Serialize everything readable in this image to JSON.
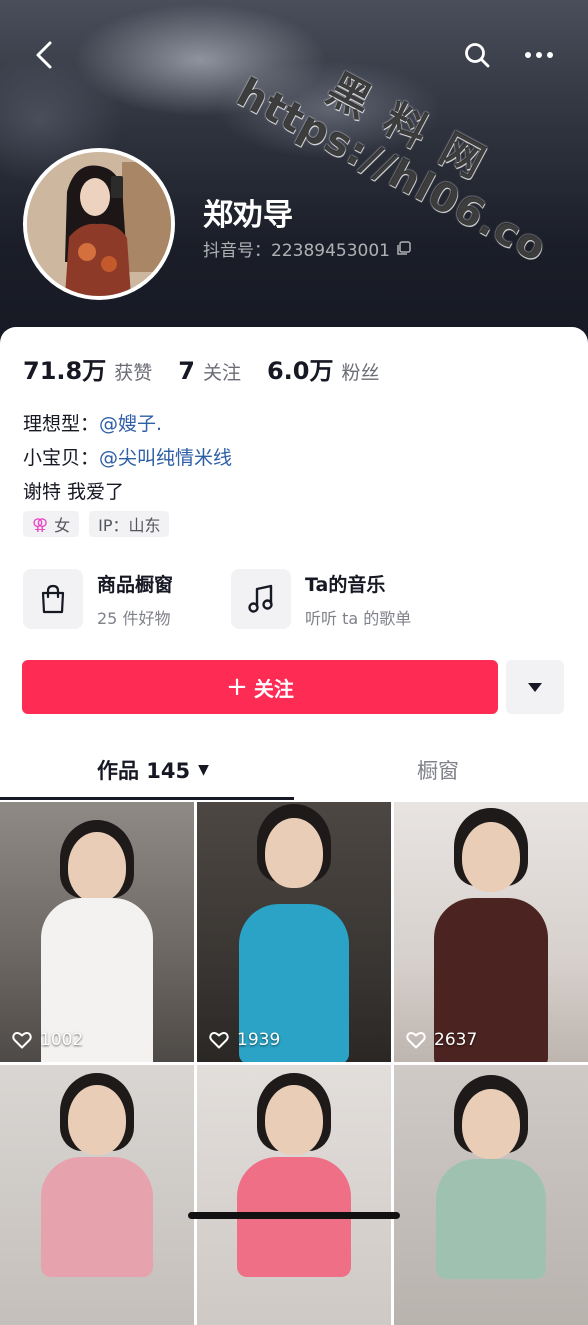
{
  "header": {
    "watermark_cn": "黑料网",
    "watermark_url": "https://hl06.co",
    "nickname": "郑劝导",
    "douyin_id": "抖音号：22389453001"
  },
  "stats": [
    {
      "num": "71.8万",
      "label": "获赞"
    },
    {
      "num": "7",
      "label": "关注"
    },
    {
      "num": "6.0万",
      "label": "粉丝"
    }
  ],
  "bio": {
    "line1_prefix": "理想型：",
    "line1_mention": "@嫂子.",
    "line2_prefix": "小宝贝：",
    "line2_mention": "@尖叫纯情米线",
    "line3": "谢特 我爱了"
  },
  "tags": {
    "gender": "女",
    "ip": "IP：山东"
  },
  "features": [
    {
      "title": "商品橱窗",
      "sub": "25 件好物",
      "icon": "shopping-bag-icon"
    },
    {
      "title": "Ta的音乐",
      "sub": "听听 ta 的歌单",
      "icon": "music-note-icon"
    }
  ],
  "follow": {
    "label": "关注"
  },
  "tabs": {
    "works": "作品 145",
    "shop": "橱窗"
  },
  "videos": [
    {
      "likes": "1002"
    },
    {
      "likes": "1939"
    },
    {
      "likes": "2637"
    },
    {
      "likes": ""
    },
    {
      "likes": ""
    },
    {
      "likes": ""
    }
  ],
  "colors": {
    "accent": "#fe2c55",
    "mention": "#2d5ea6",
    "text": "#161823"
  }
}
